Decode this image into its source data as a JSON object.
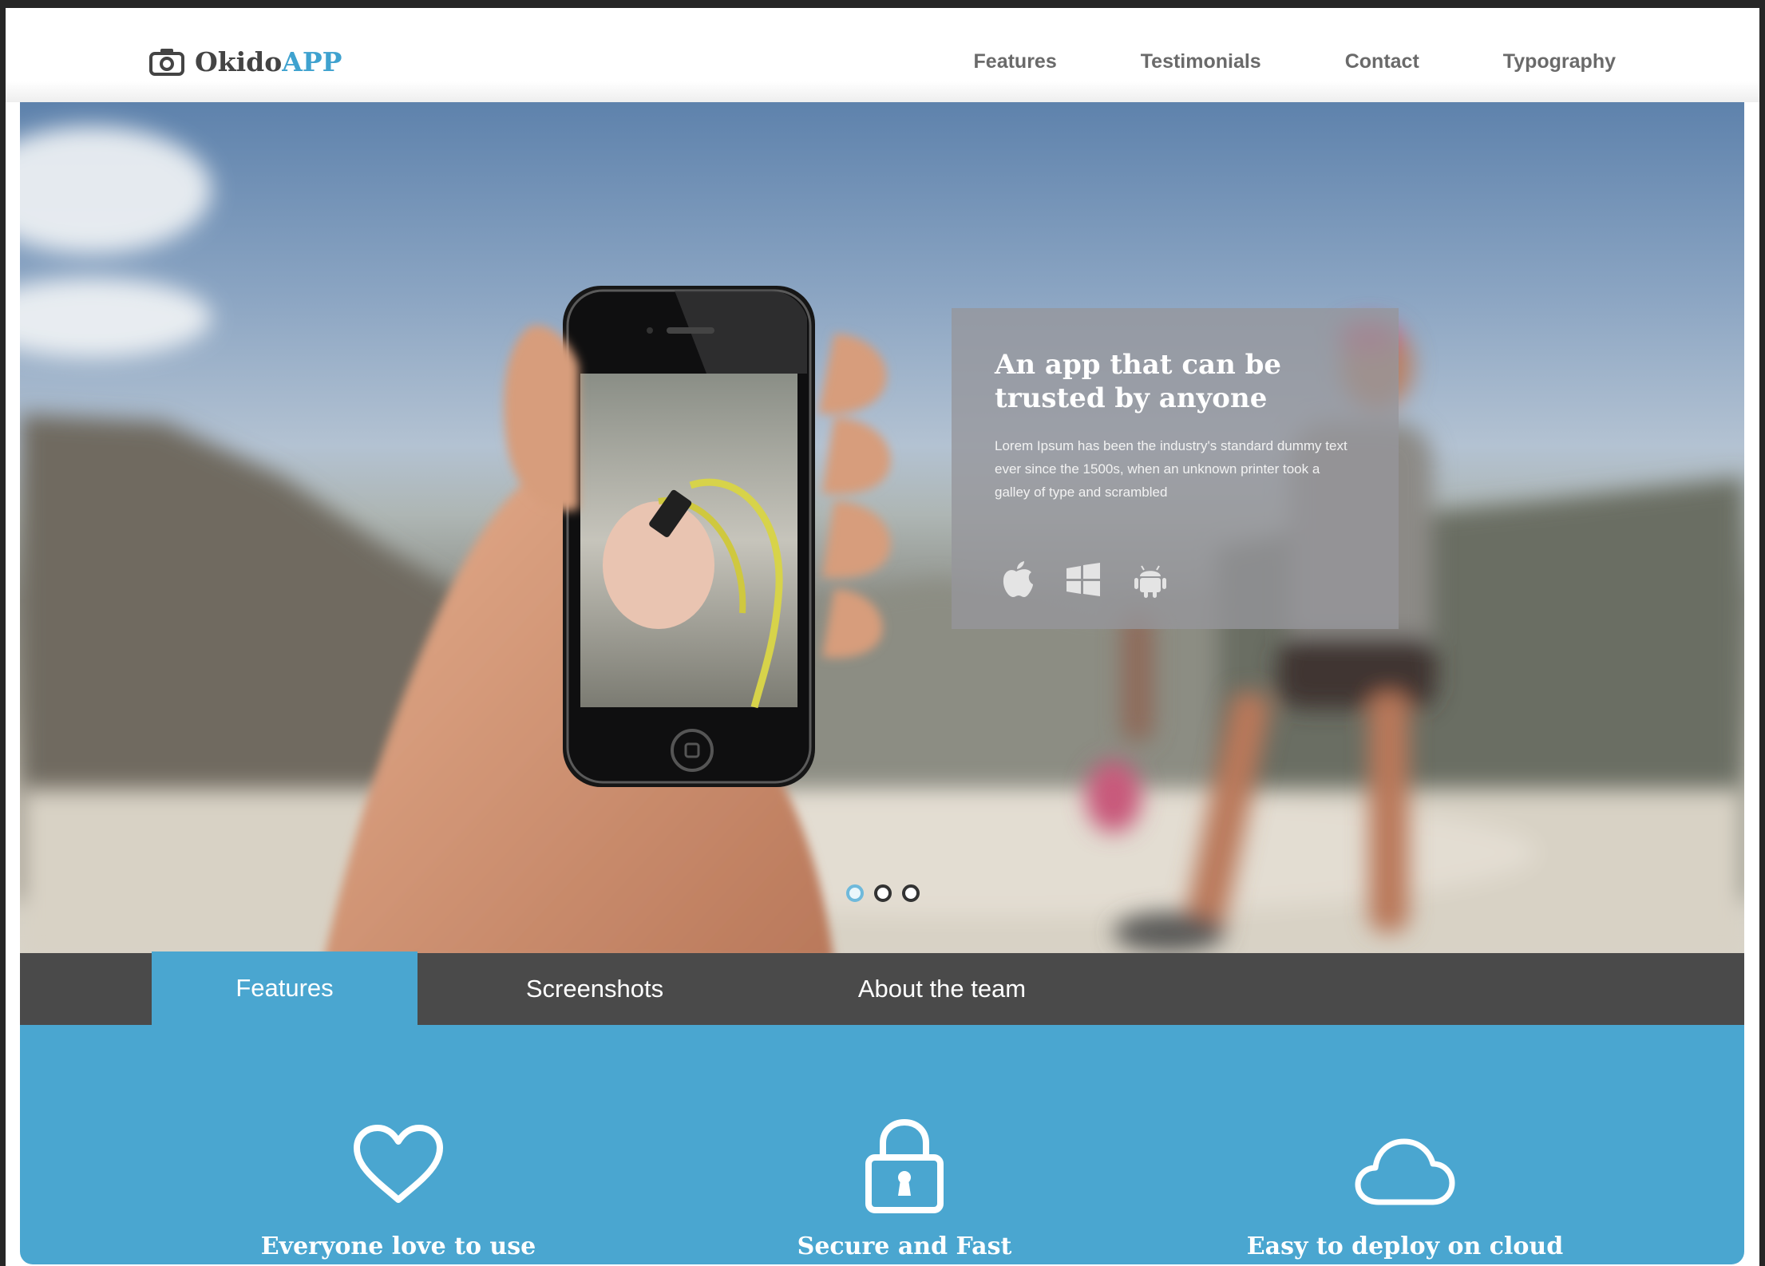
{
  "brand": {
    "name_part1": "Okido",
    "name_part2": "APP",
    "icon": "camera-icon",
    "accent_color": "#3fa2cf"
  },
  "topnav": {
    "items": [
      "Features",
      "Testimonials",
      "Contact",
      "Typography"
    ]
  },
  "hero": {
    "title": "An app that can be trusted by anyone",
    "text": "Lorem Ipsum has been the industry's standard dummy text ever since the 1500s, when an unknown printer took a galley of type and scrambled",
    "platform_icons": [
      "apple-icon",
      "windows-icon",
      "android-icon"
    ],
    "slides": {
      "count": 3,
      "active": 1
    }
  },
  "tabs": {
    "items": [
      "Features",
      "Screenshots",
      "About the team"
    ],
    "active": "Features",
    "active_color": "#4aa6d0",
    "bar_color": "#4a4a4a"
  },
  "features": {
    "items": [
      {
        "label": "Everyone love to use",
        "icon": "heart-icon"
      },
      {
        "label": "Secure and Fast",
        "icon": "lock-icon"
      },
      {
        "label": "Easy to deploy on cloud",
        "icon": "cloud-icon"
      }
    ],
    "background": "#4aa6d0"
  }
}
